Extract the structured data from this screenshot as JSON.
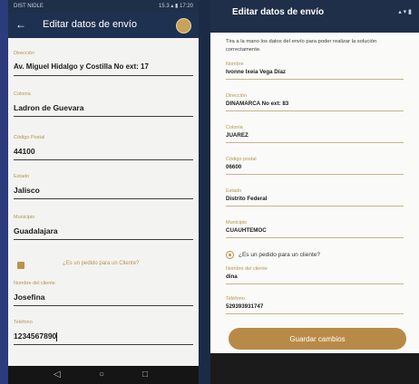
{
  "left_screen": {
    "status_left": "DIST NIDLE",
    "status_right": "15.3 ▴ ▮ 17:20",
    "back_icon": "back-arrow-icon",
    "title": "Editar datos de envío",
    "fields": [
      {
        "label": "Dirección",
        "value": "Av. Miguel Hidalgo y Costilla No ext: 17"
      },
      {
        "label": "Colonia",
        "value": "Ladron de Guevara"
      },
      {
        "label": "Código Postal",
        "value": "44100"
      },
      {
        "label": "Estado",
        "value": "Jalisco"
      },
      {
        "label": "Municipio",
        "value": "Guadalajara"
      }
    ],
    "client_question": "¿Es un pedido para un Cliente?",
    "client_checked": true,
    "client_fields": [
      {
        "label": "Nombre del cliente",
        "value": "Josefina"
      },
      {
        "label": "Teléfono",
        "value": "1234567890"
      }
    ],
    "nav": [
      "◁",
      "○",
      "□"
    ]
  },
  "right_screen": {
    "title": "Editar datos de envío",
    "status_icons": "▴ ▾ ▮",
    "intro": "Tira a la mano los datos del envío para poder realizar la solución correctamente.",
    "fields": [
      {
        "label": "Nombre",
        "value": "Ivonne Ixeia Vega Díaz"
      },
      {
        "label": "Dirección",
        "value": "DINAMARCA No ext: 83"
      },
      {
        "label": "Colonia",
        "value": "JUAREZ"
      },
      {
        "label": "Código postal",
        "value": "06600"
      },
      {
        "label": "Estado",
        "value": "Distrito Federal"
      },
      {
        "label": "Municipio",
        "value": "CUAUHTEMOC"
      }
    ],
    "client_question": "¿Es un pedido para un cliente?",
    "client_fields": [
      {
        "label": "Nombre del cliente",
        "value": "dina"
      },
      {
        "label": "Teléfono",
        "value": "529393931747"
      }
    ],
    "save_label": "Guardar cambios"
  },
  "colors": {
    "accent_gold": "#b8934f",
    "header_navy": "#1f3150",
    "button_gold": "#b88a47"
  }
}
